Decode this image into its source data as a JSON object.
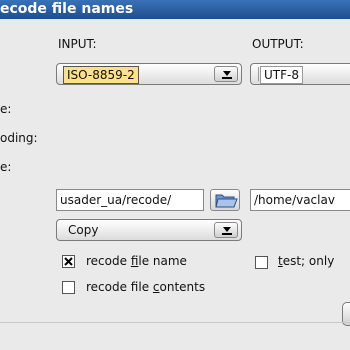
{
  "window": {
    "title": "ecode file names"
  },
  "headers": {
    "input": "INPUT:",
    "output": "OUTPUT:"
  },
  "left_labels": [
    "e:",
    "oding:",
    "e:"
  ],
  "encoding": {
    "input_value": "ISO-8859-2",
    "output_value": "UTF-8"
  },
  "paths": {
    "input_dir": "usader_ua/recode/",
    "output_dir": "/home/vaclav"
  },
  "mode": {
    "value": "Copy"
  },
  "options": {
    "recode_name": {
      "label_pre": "recode ",
      "label_key": "f",
      "label_post": "ile name",
      "checked": true
    },
    "test": {
      "label_key": "t",
      "label_post": "est; only",
      "checked": false
    },
    "recode_contents": {
      "label_pre": "recode file ",
      "label_key": "c",
      "label_post": "ontents",
      "checked": false
    }
  },
  "icons": {
    "dropdown": "dropdown-arrow-icon",
    "folder": "folder-open-icon",
    "checkmark": "x-check-icon"
  },
  "colors": {
    "titlebar": "#2a5ea8",
    "selection": "#fde08a"
  }
}
